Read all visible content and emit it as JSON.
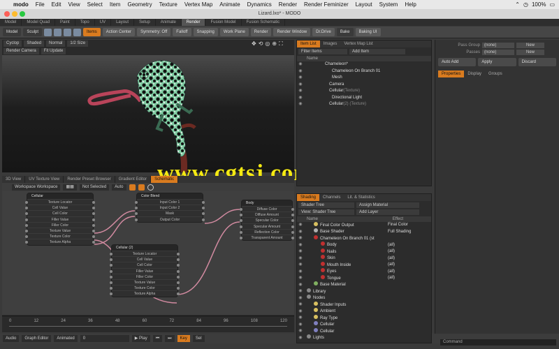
{
  "menubar": {
    "app": "modo",
    "items": [
      "File",
      "Edit",
      "View",
      "Select",
      "Item",
      "Geometry",
      "Texture",
      "Vertex Map",
      "Animate",
      "Dynamics",
      "Render",
      "Render Feminizer",
      "Layout",
      "System",
      "Help"
    ],
    "right": [
      "⌃",
      "◷",
      "100%",
      "▭"
    ]
  },
  "window": {
    "title": "Lizard.lxo* - MODO"
  },
  "layout_tabs": [
    "Model",
    "Model Quad",
    "Paint",
    "Topo",
    "UV",
    "Layout",
    "Setup",
    "Animate",
    "Render",
    "Fusion Model",
    "Fusion Schematic"
  ],
  "layout_tab_active": "Render",
  "toolbar": {
    "mode": "Model",
    "sculpt": "Sculpt",
    "items": "Items",
    "action_center": "Action Center",
    "symmetry": "Symmetry: Off",
    "falloff": "Falloff",
    "snapping": "Snapping",
    "work_plane": "Work Plane",
    "render": "Render",
    "render_window": "Render Window",
    "drive": "Dr.Drive",
    "bake": "Bake",
    "baking_ui": "Baking UI"
  },
  "viewport": {
    "row1": [
      "Cyclop",
      "Shaded",
      "Normal",
      "1/2 Size"
    ],
    "row2": [
      "Render Camera",
      "Fit Update"
    ],
    "icons": [
      "✥",
      "⟲",
      "◎",
      "⊕",
      "⛶"
    ]
  },
  "watermark": "www.cgtsj.com",
  "node_tabs": [
    "3D View",
    "UV Texture View",
    "Render Preset Browser",
    "Gradient Editor",
    "Schematic"
  ],
  "node_tab_active": "Schematic",
  "node_toolbar": [
    "Workspace Workspace",
    "▦▦",
    "Not Selected",
    "Auto"
  ],
  "nodes": {
    "cellular1": {
      "title": "Cellular",
      "props": [
        "Texture Locator",
        "Cell Value",
        "Cell Color",
        "Filler Value",
        "Filler Color",
        "Texture Value",
        "Texture Color",
        "Texture Alpha"
      ]
    },
    "cellular2": {
      "title": "Cellular (2)",
      "props": [
        "Texture Locator",
        "Cell Value",
        "Cell Color",
        "Filler Value",
        "Filler Color",
        "Texture Value",
        "Texture Color",
        "Texture Alpha"
      ]
    },
    "colorblend": {
      "title": "Color Blend",
      "props": [
        "Input Color 1",
        "Input Color 2",
        "Mask",
        "Output Color"
      ]
    },
    "body": {
      "title": "Body",
      "props": [
        "Diffuse Color",
        "Diffuse Amount",
        "Specular Color",
        "Specular Amount",
        "Reflection Color",
        "Transparent Amount"
      ]
    }
  },
  "timeline": {
    "ticks": [
      "0",
      "12",
      "24",
      "36",
      "48",
      "60",
      "72",
      "84",
      "96",
      "108",
      "120"
    ]
  },
  "bottombar": [
    "Audio",
    "Graph Editor",
    "Animated",
    "0",
    "▶ Play",
    "⏮",
    "⏭",
    "Key",
    "Sel"
  ],
  "item_panel": {
    "tabs": [
      "Item List",
      "Images",
      "Vertex Map List"
    ],
    "tool": [
      "Filter Items",
      "Add Item"
    ],
    "col": "Name",
    "items": [
      {
        "name": "Chameleon*",
        "sub": ""
      },
      {
        "name": "Chameleon On Branch 01",
        "sub": ""
      },
      {
        "name": "Mesh",
        "sub": ""
      },
      {
        "name": "Camera",
        "sub": ""
      },
      {
        "name": "Cellular",
        "sub": "(Texture)"
      },
      {
        "name": "Directional Light",
        "sub": ""
      },
      {
        "name": "Cellular",
        "sub": "(2) (Texture)"
      }
    ]
  },
  "shader_panel": {
    "tabs": [
      "Shading",
      "Channels",
      "Lit. & Statistics"
    ],
    "view": "Shader Tree",
    "filter": "Assign Material",
    "tool": [
      "View: Shader Tree",
      "Add Layer"
    ],
    "cols": [
      "Name",
      "Effect"
    ],
    "rows": [
      {
        "name": "Final Color Output",
        "effect": "Final Color",
        "color": "#d8c060"
      },
      {
        "name": "Base Shader",
        "effect": "Full Shading",
        "color": "#b0b0b0"
      },
      {
        "name": "Chameleon On Branch 01 (st",
        "effect": "",
        "color": "#c03030"
      },
      {
        "name": "Body",
        "effect": "(all)",
        "color": "#c03030"
      },
      {
        "name": "Nails",
        "effect": "(all)",
        "color": "#c03030"
      },
      {
        "name": "Skin",
        "effect": "(all)",
        "color": "#c03030"
      },
      {
        "name": "Mouth Inside",
        "effect": "(all)",
        "color": "#c03030"
      },
      {
        "name": "Eyes",
        "effect": "(all)",
        "color": "#c03030"
      },
      {
        "name": "Tongue",
        "effect": "(all)",
        "color": "#c03030"
      },
      {
        "name": "Base Material",
        "effect": "",
        "color": "#80b060"
      },
      {
        "name": "Library",
        "effect": "",
        "color": "#888"
      },
      {
        "name": "Nodes",
        "effect": "",
        "color": "#888"
      },
      {
        "name": "Shader Inputs",
        "effect": "",
        "color": "#d8c060"
      },
      {
        "name": "Ambient",
        "effect": "",
        "color": "#d8c060"
      },
      {
        "name": "Ray Type",
        "effect": "",
        "color": "#d8c060"
      },
      {
        "name": "Cellular",
        "effect": "",
        "color": "#8080c0"
      },
      {
        "name": "Cellular",
        "effect": "",
        "color": "#8080c0"
      },
      {
        "name": "Lights",
        "effect": "",
        "color": "#888"
      }
    ]
  },
  "prop_panel": {
    "fields": [
      {
        "label": "Pass Group",
        "value": "(none)",
        "btn": "New"
      },
      {
        "label": "Passes",
        "value": "(none)",
        "btn": "New"
      }
    ],
    "buttons": [
      "Auto Add",
      "Apply",
      "Discard"
    ],
    "tabs": [
      "Properties",
      "Display",
      "Groups"
    ]
  },
  "command": "Command",
  "colors": {
    "accent": "#d97b1f",
    "watermark": "#f5ea12"
  }
}
